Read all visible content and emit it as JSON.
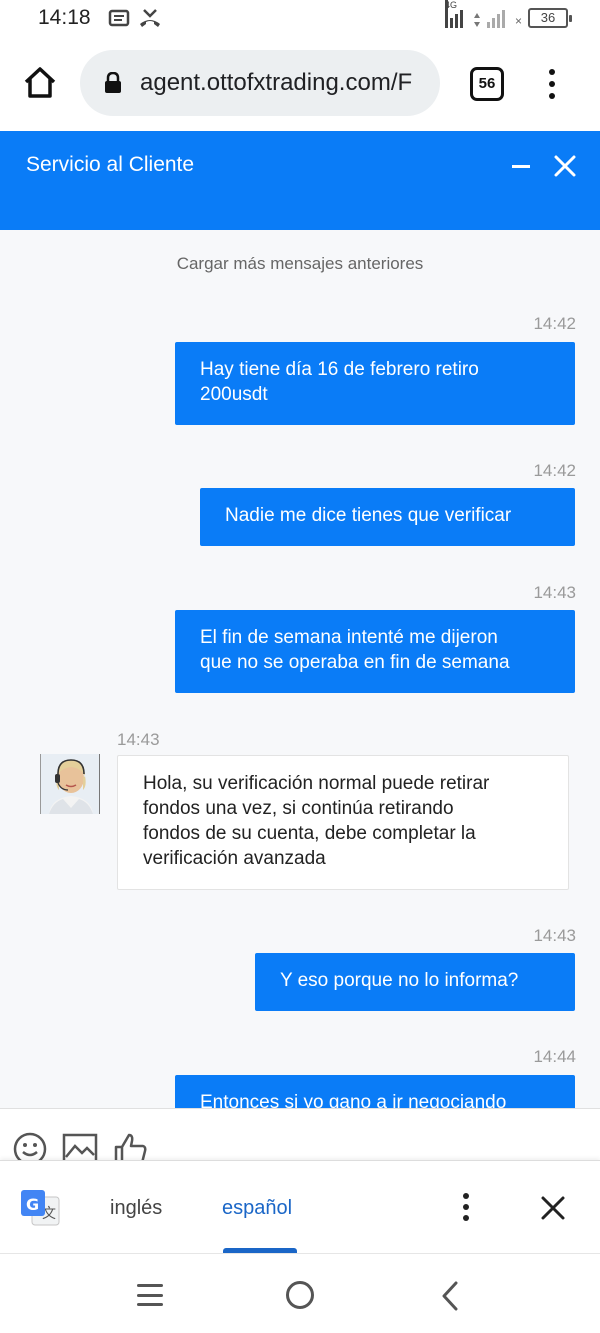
{
  "status_bar": {
    "time": "14:18",
    "network": "4G",
    "battery": "36"
  },
  "browser": {
    "url": "agent.ottofxtrading.com/F",
    "tab_count": "56"
  },
  "chat": {
    "title": "Servicio al Cliente",
    "load_more": "Cargar más mensajes anteriores",
    "messages": [
      {
        "time": "14:42",
        "line1": "Hay tiene día 16 de febrero retiro",
        "line2": "200usdt"
      },
      {
        "time": "14:42",
        "line1": "Nadie me dice tienes que verificar"
      },
      {
        "time": "14:43",
        "line1": "El fin de semana intenté me dijeron",
        "line2": "que no se operaba en fin de semana"
      },
      {
        "time": "14:43",
        "line1": "Hola, su verificación normal puede retirar",
        "line2": "fondos una vez, si continúa retirando",
        "line3": "fondos de su cuenta, debe completar la",
        "line4": "verificación avanzada"
      },
      {
        "time": "14:43",
        "line1": "Y eso porque no lo informa?"
      },
      {
        "time": "14:44",
        "line1": "Entonces si yo gano a ir negociando"
      }
    ]
  },
  "translate": {
    "source_lang": "inglés",
    "target_lang": "español"
  },
  "icons": {
    "home": "home-icon",
    "lock": "lock-icon",
    "emoji": "emoji-icon",
    "image": "image-icon",
    "thumbs_up": "thumbs-up-icon",
    "google_translate": "google-translate-icon"
  },
  "colors": {
    "accent": "#0a7cf7",
    "translate_active": "#1a66c7"
  }
}
